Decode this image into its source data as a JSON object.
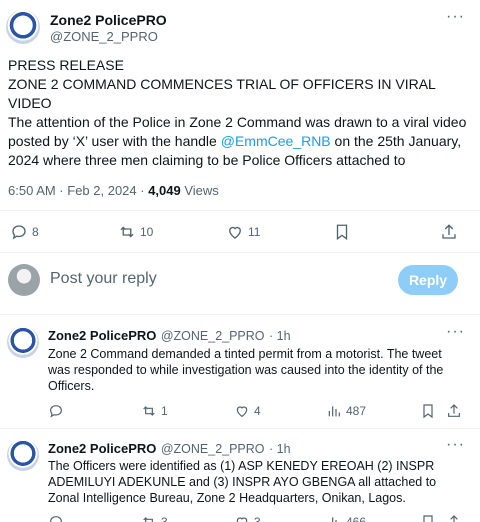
{
  "main_tweet": {
    "author_name": "Zone2 PolicePRO",
    "author_handle": "@ZONE_2_PPRO",
    "line1": "PRESS RELEASE",
    "line2": "ZONE 2 COMMAND COMMENCES TRIAL OF OFFICERS IN VIRAL VIDEO",
    "body_pre": "The attention of the Police in Zone 2 Command was drawn to a viral video posted by ‘X’ user with the handle ",
    "mention": "@EmmCee_RNB",
    "body_post": " on the 25th January, 2024 where three men claiming to be Police Officers attached to",
    "time": "6:50 AM · Feb 2, 2024 · ",
    "views_count": "4,049",
    "views_label": " Views",
    "replies": "8",
    "reposts": "10",
    "likes": "11"
  },
  "composer": {
    "placeholder": "Post your reply",
    "reply_label": "Reply"
  },
  "replies": [
    {
      "author_name": "Zone2 PolicePRO",
      "author_handle": "@ZONE_2_PPRO",
      "time": "· 1h",
      "text": "Zone 2 Command demanded a tinted permit from a motorist. The tweet was responded to while investigation was caused into the identity of the Officers.",
      "reposts": "1",
      "likes": "4",
      "views": "487"
    },
    {
      "author_name": "Zone2 PolicePRO",
      "author_handle": "@ZONE_2_PPRO",
      "time": "· 1h",
      "text": "The Officers were identified as (1) ASP KENEDY EREOAH (2) INSPR ADEMILUYI ADEKUNLE and (3) INSPR AYO GBENGA all attached to Zonal Intelligence Bureau, Zone 2 Headquarters, Onikan, Lagos.",
      "reposts": "3",
      "likes": "3",
      "views": "466"
    }
  ],
  "colors": {
    "accent": "#1d9bf0",
    "reply_button": "#8ecdf8",
    "muted": "#536471"
  }
}
